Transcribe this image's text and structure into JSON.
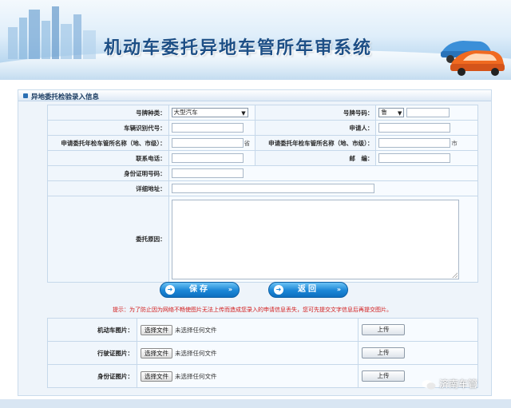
{
  "header": {
    "title": "机动车委托异地车管所年审系统"
  },
  "section": {
    "title": "异地委托检验录入信息"
  },
  "form": {
    "plate_type_label": "号牌种类：",
    "plate_type_value": "大型汽车",
    "plate_number_label": "号牌号码：",
    "plate_prefix_value": "鲁",
    "plate_number_value": "",
    "vin_label": "车辆识别代号：",
    "vin_value": "",
    "applicant_label": "申请人：",
    "applicant_value": "",
    "province_office_label": "申请委托年检车管所名称（地、市级）：",
    "province_office_value": "",
    "province_suffix": "省",
    "city_office_label": "申请委托年检车管所名称（地、市级）：",
    "city_office_value": "",
    "city_suffix": "市",
    "phone_label": "联系电话：",
    "phone_value": "",
    "postcode_label": "邮　编：",
    "postcode_value": "",
    "id_label": "身份证明号码：",
    "id_value": "",
    "address_label": "详细地址：",
    "address_value": "",
    "reason_label": "委托原因：",
    "reason_value": ""
  },
  "buttons": {
    "save": "保存",
    "back": "返回"
  },
  "tip": "提示：为了防止因为网络不畅使图片无法上传而造成您录入的申请信息丢失，您可先提交文字信息后再提交图片。",
  "uploads": [
    {
      "label": "机动车图片：",
      "choose": "选择文件",
      "status": "未选择任何文件",
      "upload": "上传"
    },
    {
      "label": "行驶证图片：",
      "choose": "选择文件",
      "status": "未选择任何文件",
      "upload": "上传"
    },
    {
      "label": "身份证图片：",
      "choose": "选择文件",
      "status": "未选择任何文件",
      "upload": "上传"
    }
  ],
  "watermark": "济南车管",
  "colors": {
    "title": "#1d4f86",
    "accent": "#1b86d6",
    "tip": "#d21a1a"
  }
}
